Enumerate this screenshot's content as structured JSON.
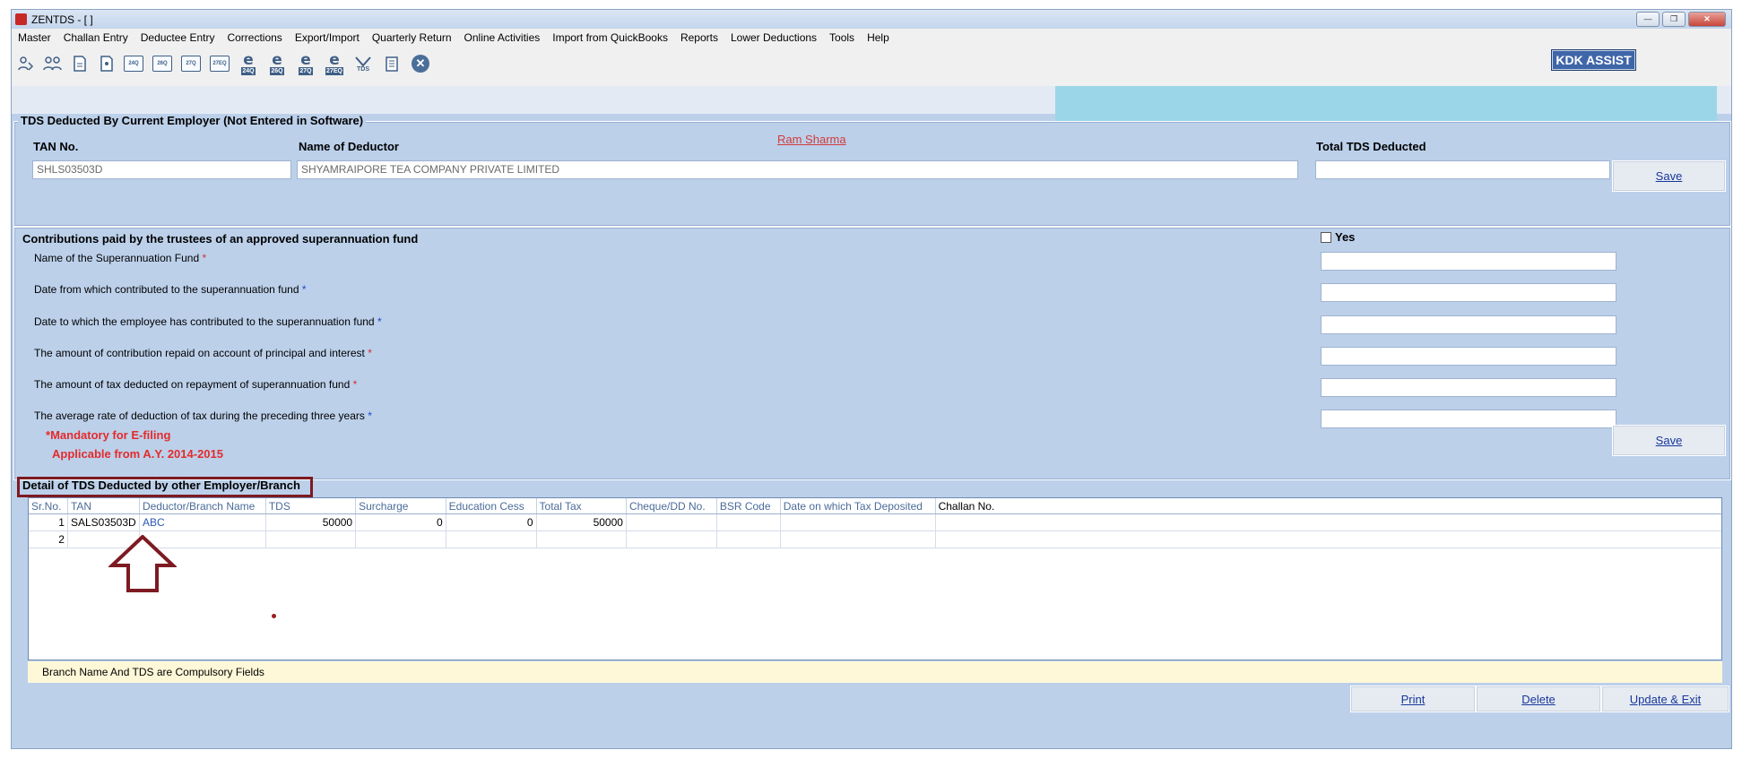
{
  "window": {
    "title": "ZENTDS - [ ]",
    "controls": [
      "minimize",
      "restore",
      "close"
    ]
  },
  "menu": [
    "Master",
    "Challan Entry",
    "Deductee Entry",
    "Corrections",
    "Export/Import",
    "Quarterly Return",
    "Online Activities",
    "Import from QuickBooks",
    "Reports",
    "Lower Deductions",
    "Tools",
    "Help"
  ],
  "toolbar": {
    "kdk_assist": "KDK ASSIST",
    "form_icons": [
      "24Q",
      "26Q",
      "27Q",
      "27EQ"
    ],
    "efile_icons": [
      "24Q",
      "26Q",
      "27Q",
      "27EQ"
    ],
    "tds_label": "TDS"
  },
  "current_employer": {
    "legend": "TDS Deducted By Current Employer (Not Entered in Software)",
    "tan_label": "TAN No.",
    "tan_value": "SHLS03503D",
    "deductor_label": "Name of Deductor",
    "deductor_value": "SHYAMRAIPORE TEA COMPANY PRIVATE LIMITED",
    "employee_link": "Ram Sharma",
    "total_label": "Total TDS Deducted",
    "total_value": "",
    "save": "Save"
  },
  "superannuation": {
    "heading": "Contributions paid by the trustees of an approved superannuation fund",
    "yes_label": "Yes",
    "yes_checked": false,
    "fields": [
      {
        "label": "Name of the Superannuation Fund",
        "value": ""
      },
      {
        "label": "Date from which contributed to the superannuation fund",
        "value": ""
      },
      {
        "label": "Date to which the employee has contributed to the superannuation fund",
        "value": ""
      },
      {
        "label": "The amount of contribution repaid on account of principal and interest",
        "value": ""
      },
      {
        "label": "The amount of tax deducted on repayment of superannuation fund",
        "value": ""
      },
      {
        "label": "The average rate of deduction of tax during the preceding three years",
        "value": ""
      }
    ],
    "mandatory_star": "*",
    "mandatory_note": "Mandatory for E-filing",
    "applicable_note": "Applicable from A.Y. 2014-2015",
    "save": "Save"
  },
  "other_employer": {
    "legend": "Detail of TDS Deducted by other Employer/Branch",
    "columns": [
      "Sr.No.",
      "TAN",
      "Deductor/Branch Name",
      "TDS",
      "Surcharge",
      "Education Cess",
      "Total Tax",
      "Cheque/DD No.",
      "BSR Code",
      "Date on which Tax Deposited",
      "Challan No."
    ],
    "rows": [
      [
        "1",
        "SALS03503D",
        "ABC",
        "50000",
        "0",
        "0",
        "50000",
        "",
        "",
        "",
        ""
      ],
      [
        "2",
        "",
        "",
        "",
        "",
        "",
        "",
        "",
        "",
        "",
        ""
      ]
    ],
    "footer_note": "Branch Name And TDS are Compulsory Fields"
  },
  "actions": {
    "print": "Print",
    "delete": "Delete",
    "update_exit": "Update & Exit"
  },
  "colors": {
    "form_bg": "#bcd0ea",
    "highlight_border": "#7d1a22",
    "mandatory_red": "#e32b2b",
    "link_blue": "#17379a"
  }
}
